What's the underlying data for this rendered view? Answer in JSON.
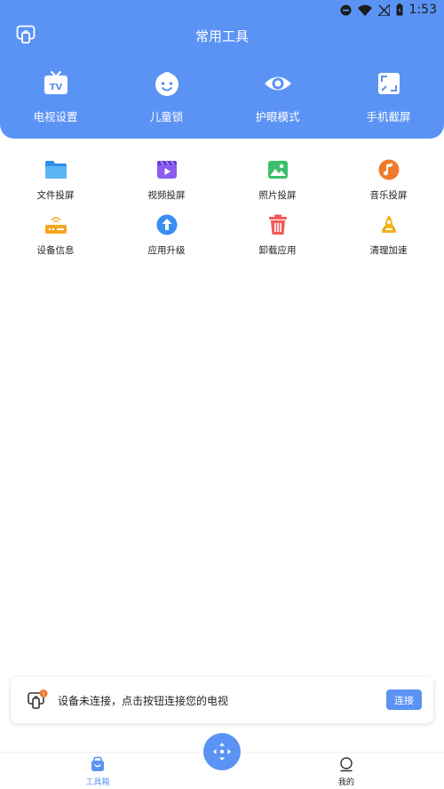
{
  "status_bar": {
    "time": "1:53",
    "icons": [
      "do-not-disturb-icon",
      "wifi-icon",
      "no-signal-icon",
      "battery-icon"
    ]
  },
  "header": {
    "title": "常用工具",
    "cast_icon": "cast-icon",
    "background_color": "#5b93f4"
  },
  "top_tools": [
    {
      "label": "电视设置",
      "icon": "tv-icon"
    },
    {
      "label": "儿童锁",
      "icon": "child-face-icon"
    },
    {
      "label": "护眼模式",
      "icon": "eye-icon"
    },
    {
      "label": "手机截屏",
      "icon": "screenshot-icon"
    }
  ],
  "tools": [
    {
      "label": "文件投屏",
      "icon": "folder-icon",
      "color": "#3aa0f0"
    },
    {
      "label": "视频投屏",
      "icon": "video-icon",
      "color": "#8a5cf0"
    },
    {
      "label": "照片投屏",
      "icon": "photo-icon",
      "color": "#3bbf6a"
    },
    {
      "label": "音乐投屏",
      "icon": "music-icon",
      "color": "#f07a2a"
    },
    {
      "label": "设备信息",
      "icon": "router-icon",
      "color": "#f5a623"
    },
    {
      "label": "应用升级",
      "icon": "upgrade-icon",
      "color": "#3a8ef0"
    },
    {
      "label": "卸载应用",
      "icon": "trash-icon",
      "color": "#f05a5a"
    },
    {
      "label": "清理加速",
      "icon": "rocket-icon",
      "color": "#f5b51f"
    }
  ],
  "connect_card": {
    "message": "设备未连接，点击按钮连接您的电视",
    "button_label": "连接",
    "badge": "!"
  },
  "bottom_nav": {
    "items": [
      {
        "label": "工具箱",
        "icon": "toolbox-icon",
        "active": true
      },
      {
        "label": "我的",
        "icon": "profile-icon",
        "active": false
      }
    ],
    "fab_icon": "remote-control-icon"
  }
}
